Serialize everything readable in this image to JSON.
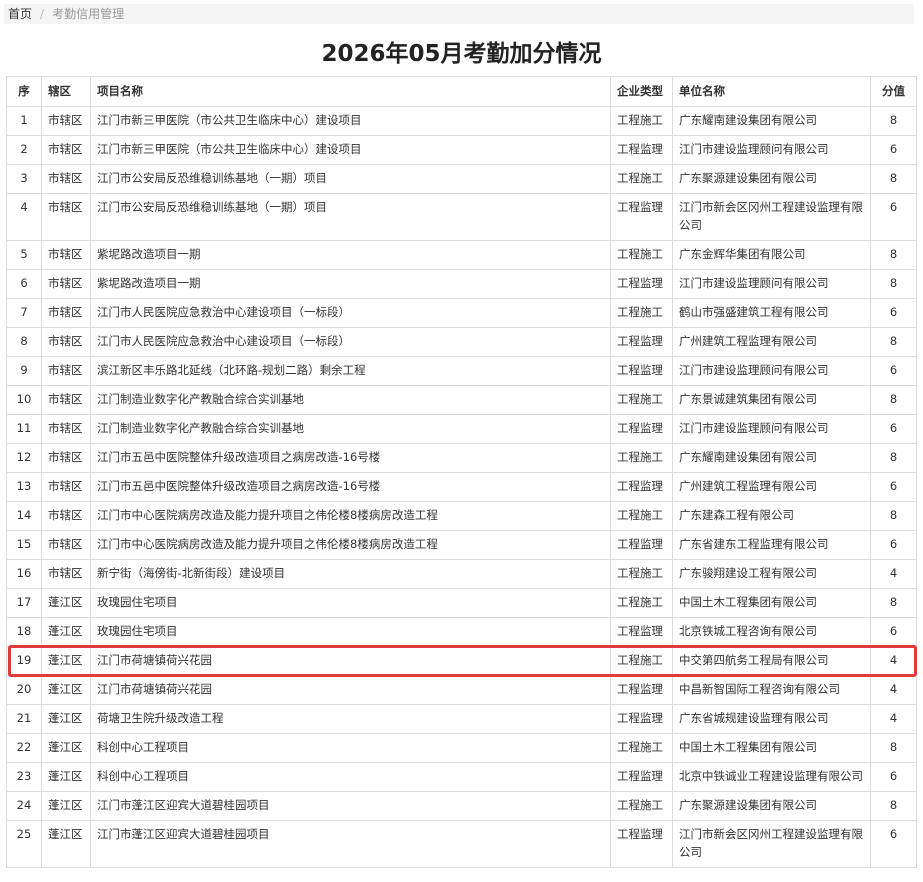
{
  "breadcrumb": {
    "home": "首页",
    "separator": "/",
    "current": "考勤信用管理"
  },
  "title": "2026年05月考勤加分情况",
  "table": {
    "headers": [
      "序",
      "辖区",
      "项目名称",
      "企业类型",
      "单位名称",
      "分值"
    ],
    "rows": [
      [
        "1",
        "市辖区",
        "江门市新三甲医院（市公共卫生临床中心）建设项目",
        "工程施工",
        "广东耀南建设集团有限公司",
        "8"
      ],
      [
        "2",
        "市辖区",
        "江门市新三甲医院（市公共卫生临床中心）建设项目",
        "工程监理",
        "江门市建设监理顾问有限公司",
        "6"
      ],
      [
        "3",
        "市辖区",
        "江门市公安局反恐维稳训练基地（一期）项目",
        "工程施工",
        "广东聚源建设集团有限公司",
        "8"
      ],
      [
        "4",
        "市辖区",
        "江门市公安局反恐维稳训练基地（一期）项目",
        "工程监理",
        "江门市新会区冈州工程建设监理有限公司",
        "6"
      ],
      [
        "5",
        "市辖区",
        "紫坭路改造项目一期",
        "工程施工",
        "广东金辉华集团有限公司",
        "8"
      ],
      [
        "6",
        "市辖区",
        "紫坭路改造项目一期",
        "工程监理",
        "江门市建设监理顾问有限公司",
        "8"
      ],
      [
        "7",
        "市辖区",
        "江门市人民医院应急救治中心建设项目（一标段）",
        "工程施工",
        "鹤山市强盛建筑工程有限公司",
        "6"
      ],
      [
        "8",
        "市辖区",
        "江门市人民医院应急救治中心建设项目（一标段）",
        "工程监理",
        "广州建筑工程监理有限公司",
        "8"
      ],
      [
        "9",
        "市辖区",
        "滨江新区丰乐路北延线（北环路-规划二路）剩余工程",
        "工程监理",
        "江门市建设监理顾问有限公司",
        "6"
      ],
      [
        "10",
        "市辖区",
        "江门制造业数字化产教融合综合实训基地",
        "工程施工",
        "广东景诚建筑集团有限公司",
        "8"
      ],
      [
        "11",
        "市辖区",
        "江门制造业数字化产教融合综合实训基地",
        "工程监理",
        "江门市建设监理顾问有限公司",
        "6"
      ],
      [
        "12",
        "市辖区",
        "江门市五邑中医院整体升级改造项目之病房改造-16号楼",
        "工程施工",
        "广东耀南建设集团有限公司",
        "8"
      ],
      [
        "13",
        "市辖区",
        "江门市五邑中医院整体升级改造项目之病房改造-16号楼",
        "工程监理",
        "广州建筑工程监理有限公司",
        "6"
      ],
      [
        "14",
        "市辖区",
        "江门市中心医院病房改造及能力提升项目之伟伦楼8楼病房改造工程",
        "工程施工",
        "广东建森工程有限公司",
        "8"
      ],
      [
        "15",
        "市辖区",
        "江门市中心医院病房改造及能力提升项目之伟伦楼8楼病房改造工程",
        "工程监理",
        "广东省建东工程监理有限公司",
        "6"
      ],
      [
        "16",
        "市辖区",
        "新宁街（海傍街-北新街段）建设项目",
        "工程施工",
        "广东骏翔建设工程有限公司",
        "4"
      ],
      [
        "17",
        "蓬江区",
        "玫瑰园住宅项目",
        "工程施工",
        "中国土木工程集团有限公司",
        "8"
      ],
      [
        "18",
        "蓬江区",
        "玫瑰园住宅项目",
        "工程监理",
        "北京铁城工程咨询有限公司",
        "6"
      ],
      [
        "19",
        "蓬江区",
        "江门市荷塘镇荷兴花园",
        "工程施工",
        "中交第四航务工程局有限公司",
        "4"
      ],
      [
        "20",
        "蓬江区",
        "江门市荷塘镇荷兴花园",
        "工程监理",
        "中昌新智国际工程咨询有限公司",
        "4"
      ],
      [
        "21",
        "蓬江区",
        "荷塘卫生院升级改造工程",
        "工程监理",
        "广东省城规建设监理有限公司",
        "4"
      ],
      [
        "22",
        "蓬江区",
        "科创中心工程项目",
        "工程施工",
        "中国土木工程集团有限公司",
        "8"
      ],
      [
        "23",
        "蓬江区",
        "科创中心工程项目",
        "工程监理",
        "北京中铁诚业工程建设监理有限公司",
        "6"
      ],
      [
        "24",
        "蓬江区",
        "江门市蓬江区迎宾大道碧桂园项目",
        "工程施工",
        "广东聚源建设集团有限公司",
        "8"
      ],
      [
        "25",
        "蓬江区",
        "江门市蓬江区迎宾大道碧桂园项目",
        "工程监理",
        "江门市新会区冈州工程建设监理有限公司",
        "6"
      ]
    ]
  },
  "highlight": {
    "row_index": 18,
    "color": "#e23b3b"
  }
}
